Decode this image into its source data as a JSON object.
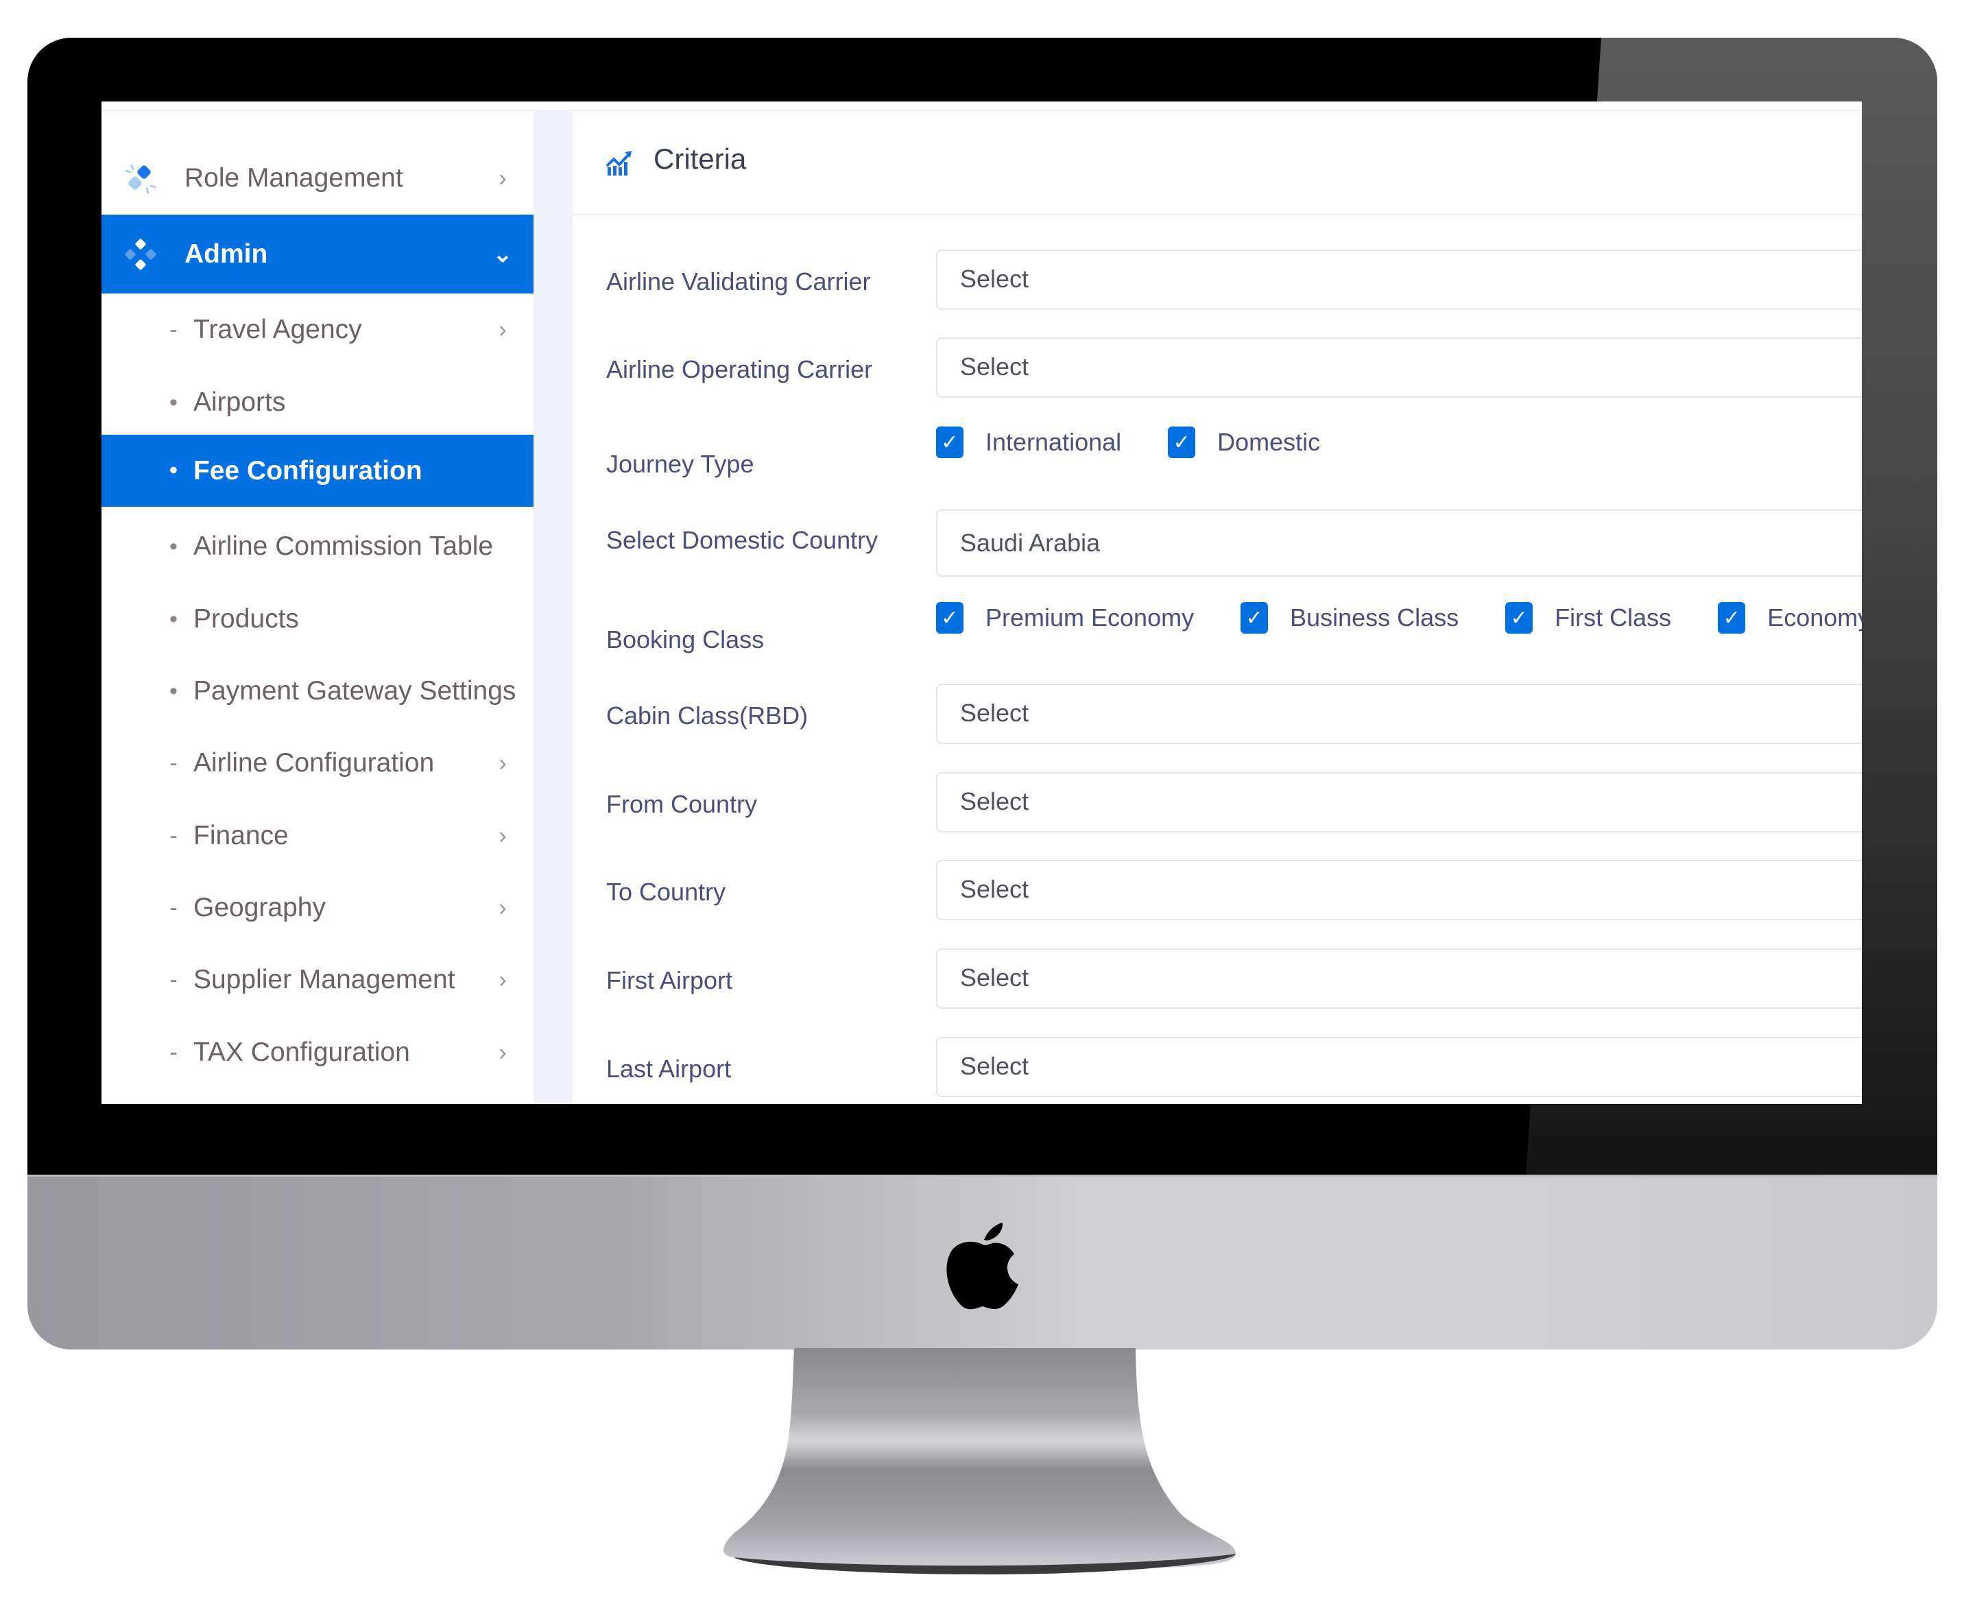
{
  "sidebar": {
    "top_items": [
      {
        "label": "Role Management",
        "icon": "role-management-icon",
        "chevron": "chevron-right",
        "active": false
      },
      {
        "label": "Admin",
        "icon": "admin-diamonds-icon",
        "chevron": "chevron-down",
        "active": true
      }
    ],
    "sub_items": [
      {
        "label": "Travel Agency",
        "marker": "-",
        "chevron": true,
        "active": false
      },
      {
        "label": "Airports",
        "marker": "•",
        "chevron": false,
        "active": false
      },
      {
        "label": "Fee Configuration",
        "marker": "•",
        "chevron": false,
        "active": true
      },
      {
        "label": "Airline Commission Table",
        "marker": "•",
        "chevron": false,
        "active": false
      },
      {
        "label": "Products",
        "marker": "•",
        "chevron": false,
        "active": false
      },
      {
        "label": "Payment Gateway Settings",
        "marker": "•",
        "chevron": false,
        "active": false
      },
      {
        "label": "Airline Configuration",
        "marker": "-",
        "chevron": true,
        "active": false
      },
      {
        "label": "Finance",
        "marker": "-",
        "chevron": true,
        "active": false
      },
      {
        "label": "Geography",
        "marker": "-",
        "chevron": true,
        "active": false
      },
      {
        "label": "Supplier Management",
        "marker": "-",
        "chevron": true,
        "active": false
      },
      {
        "label": "TAX Configuration",
        "marker": "-",
        "chevron": true,
        "active": false
      }
    ],
    "chevron_right_glyph": "›",
    "chevron_down_glyph": "⌄"
  },
  "main": {
    "section_title": "Criteria",
    "section_icon": "chart-trend-icon",
    "fields": {
      "validating_carrier": {
        "label": "Airline Validating Carrier",
        "value": "Select"
      },
      "operating_carrier": {
        "label": "Airline Operating Carrier",
        "value": "Select"
      },
      "journey_type": {
        "label": "Journey Type",
        "options": [
          {
            "label": "International",
            "checked": true
          },
          {
            "label": "Domestic",
            "checked": true
          }
        ]
      },
      "domestic_country": {
        "label": "Select Domestic Country",
        "value": "Saudi Arabia"
      },
      "booking_class": {
        "label": "Booking Class",
        "options": [
          {
            "label": "Premium Economy",
            "checked": true
          },
          {
            "label": "Business Class",
            "checked": true
          },
          {
            "label": "First Class",
            "checked": true
          },
          {
            "label": "Economy",
            "checked": true
          }
        ]
      },
      "cabin_class": {
        "label": "Cabin Class(RBD)",
        "value": "Select"
      },
      "from_country": {
        "label": "From Country",
        "value": "Select"
      },
      "to_country": {
        "label": "To Country",
        "value": "Select"
      },
      "first_airport": {
        "label": "First Airport",
        "value": "Select"
      },
      "last_airport": {
        "label": "Last Airport",
        "value": "Select"
      }
    },
    "check_glyph": "✓",
    "dropdown_glyph": "⌄"
  },
  "colors": {
    "accent": "#006fdf",
    "label_text": "#4a4f7a",
    "sidebar_text": "#6b6062"
  }
}
